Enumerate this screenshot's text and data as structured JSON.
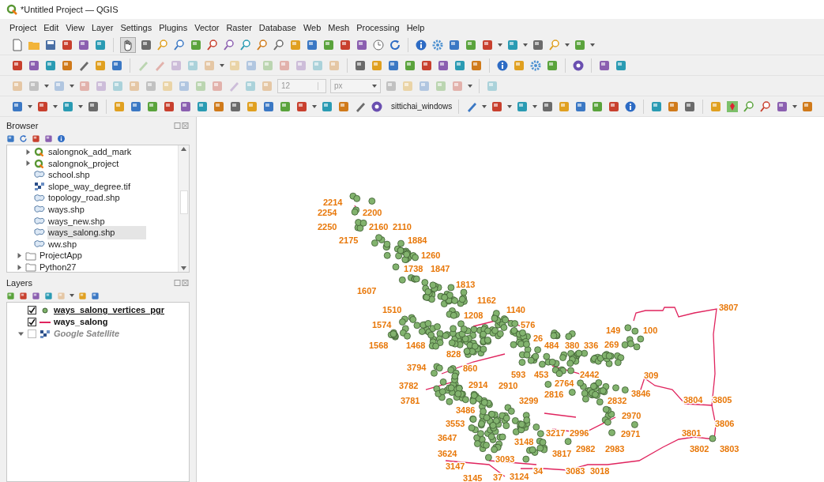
{
  "window": {
    "title": "*Untitled Project — QGIS"
  },
  "menu": [
    "Project",
    "Edit",
    "View",
    "Layer",
    "Settings",
    "Plugins",
    "Vector",
    "Raster",
    "Database",
    "Web",
    "Mesh",
    "Processing",
    "Help"
  ],
  "toolbar": {
    "font_size": "12",
    "unit": "px",
    "user": "sittichai_windows"
  },
  "browser": {
    "title": "Browser",
    "tree": [
      {
        "children": [
          {
            "label": "salongnok_add_mark",
            "kind": "project",
            "expanded": false,
            "selected": false
          },
          {
            "label": "salongnok_project",
            "kind": "project",
            "expanded": false,
            "selected": false
          },
          {
            "label": "school.shp",
            "kind": "vector",
            "selected": false
          },
          {
            "label": "slope_way_degree.tif",
            "kind": "raster",
            "selected": false
          },
          {
            "label": "topology_road.shp",
            "kind": "vector",
            "selected": false
          },
          {
            "label": "ways.shp",
            "kind": "vector",
            "selected": false
          },
          {
            "label": "ways_new.shp",
            "kind": "vector",
            "selected": false
          },
          {
            "label": "ways_salong.shp",
            "kind": "vector",
            "selected": true
          },
          {
            "label": "ww.shp",
            "kind": "vector",
            "selected": false
          }
        ]
      },
      {
        "label": "ProjectApp",
        "kind": "folder",
        "expanded": false,
        "selected": false
      },
      {
        "label": "Python27",
        "kind": "folder",
        "expanded": false,
        "selected": false
      }
    ]
  },
  "layers": {
    "title": "Layers",
    "items": [
      {
        "name": "ways_salong_vertices_pgr",
        "kind": "point",
        "checked": true,
        "selected": true
      },
      {
        "name": "ways_salong",
        "kind": "line",
        "checked": true,
        "selected": false
      },
      {
        "name": "Google Satellite",
        "kind": "raster",
        "checked": false,
        "selected": false,
        "expanded": true
      }
    ]
  },
  "map": {
    "labels": [
      "2214",
      "2254",
      "2200",
      "2250",
      "2160",
      "2110",
      "2175",
      "1884",
      "1260",
      "1738",
      "1847",
      "1813",
      "1607",
      "1162",
      "1510",
      "1140",
      "3807",
      "1208",
      "1574",
      "576",
      "149",
      "100",
      "26",
      "1568",
      "1468",
      "484",
      "380",
      "336",
      "269",
      "828",
      "3794",
      "860",
      "593",
      "453",
      "2442",
      "309",
      "3782",
      "2914",
      "2910",
      "2764",
      "2816",
      "3846",
      "3781",
      "3299",
      "2832",
      "3804",
      "3805",
      "3486",
      "2970",
      "3553",
      "3806",
      "3217",
      "2996",
      "2971",
      "3801",
      "3647",
      "3148",
      "2982",
      "2983",
      "3802",
      "3803",
      "3624",
      "3817",
      "3093",
      "3147",
      "34",
      "3083",
      "3018",
      "3145",
      "37",
      "3124"
    ]
  }
}
